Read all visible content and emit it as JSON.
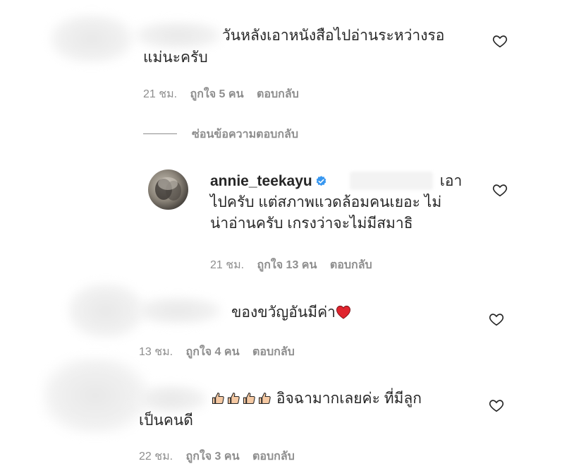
{
  "comments": [
    {
      "text_line1": "วันหลังเอาหนังสือไปอ่านระหว่างรอ",
      "text_line2": "แม่นะครับ",
      "time": "21 ชม.",
      "likes": "ถูกใจ 5 คน",
      "reply": "ตอบกลับ"
    },
    {
      "text": "ของขวัญอันมีค่า",
      "time": "13 ชม.",
      "likes": "ถูกใจ 4 คน",
      "reply": "ตอบกลับ"
    },
    {
      "text_line1": "อิจฉามากเลยค่ะ ที่มีลูก",
      "text_line2": "เป็นคนดี",
      "time": "22 ชม.",
      "likes": "ถูกใจ 3 คน",
      "reply": "ตอบกลับ"
    }
  ],
  "hide_replies": "ซ่อนข้อความตอบกลับ",
  "reply": {
    "username": "annie_teekayu",
    "text_line1_end": "เอา",
    "text_line2": "ไปครับ แต่สภาพแวดล้อมคนเยอะ ไม่",
    "text_line3": "น่าอ่านครับ เกรงว่าจะไม่มีสมาธิ",
    "time": "21 ชม.",
    "likes": "ถูกใจ 13 คน",
    "reply": "ตอบกลับ"
  },
  "icons": {
    "heart": "heart-outline-icon",
    "verified": "verified-badge-icon",
    "red_heart": "red-heart-emoji",
    "thumbs_up": "thumbs-up-emoji"
  },
  "colors": {
    "text": "#262626",
    "secondary": "#8e8e8e",
    "verified": "#3897f0",
    "red_heart": "#e0242e"
  }
}
